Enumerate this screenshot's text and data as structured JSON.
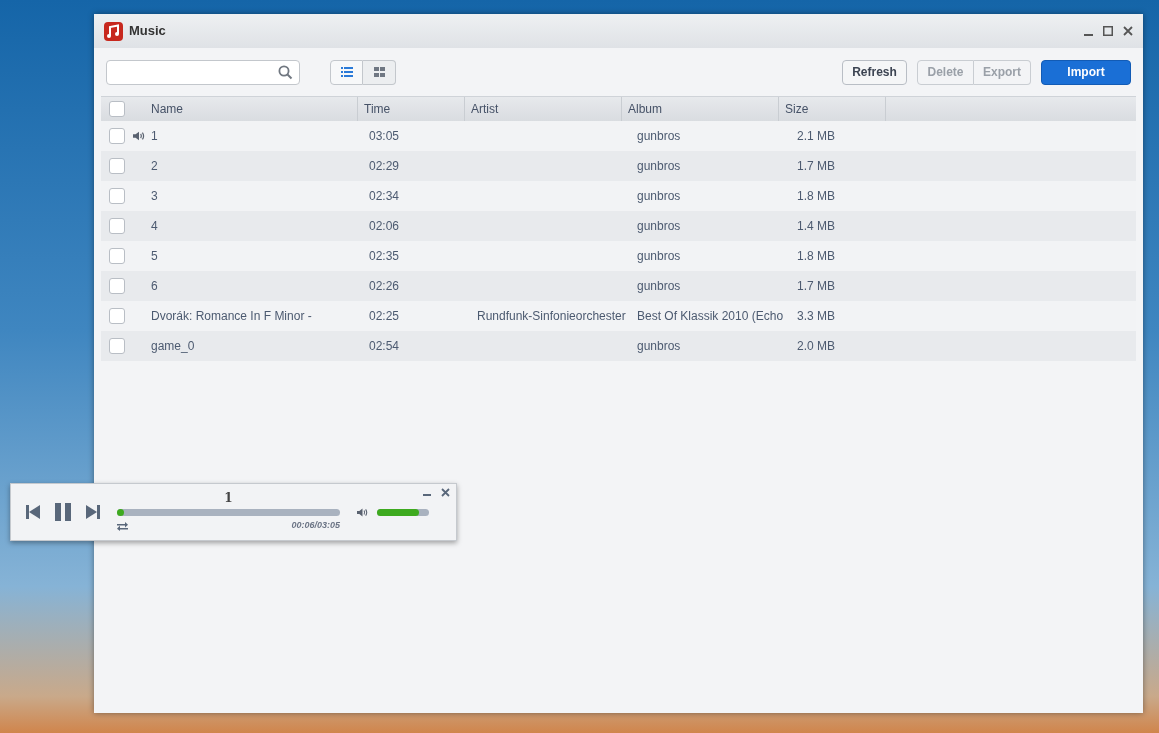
{
  "window": {
    "title": "Music"
  },
  "toolbar": {
    "view_modes": [
      {
        "kind": "list",
        "selected": true
      },
      {
        "kind": "grid",
        "selected": false
      }
    ],
    "buttons": [
      {
        "label": "Refresh",
        "disabled": false,
        "kind": "plain"
      },
      {
        "label": "Delete",
        "disabled": true,
        "kind": "group"
      },
      {
        "label": "Export",
        "disabled": true,
        "kind": "group"
      },
      {
        "label": "Import",
        "disabled": false,
        "kind": "primary"
      }
    ]
  },
  "table": {
    "select_all": {
      "checked": false
    },
    "columns": [
      "Name",
      "Time",
      "Artist",
      "Album",
      "Size"
    ],
    "rows": [
      {
        "checked": false,
        "playing": true,
        "cells": [
          "1",
          "03:05",
          "",
          "gunbros",
          "2.1 MB"
        ]
      },
      {
        "checked": false,
        "playing": false,
        "cells": [
          "2",
          "02:29",
          "",
          "gunbros",
          "1.7 MB"
        ]
      },
      {
        "checked": false,
        "playing": false,
        "cells": [
          "3",
          "02:34",
          "",
          "gunbros",
          "1.8 MB"
        ]
      },
      {
        "checked": false,
        "playing": false,
        "cells": [
          "4",
          "02:06",
          "",
          "gunbros",
          "1.4 MB"
        ]
      },
      {
        "checked": false,
        "playing": false,
        "cells": [
          "5",
          "02:35",
          "",
          "gunbros",
          "1.8 MB"
        ]
      },
      {
        "checked": false,
        "playing": false,
        "cells": [
          "6",
          "02:26",
          "",
          "gunbros",
          "1.7 MB"
        ]
      },
      {
        "checked": false,
        "playing": false,
        "cells": [
          "Dvorák: Romance In F Minor -",
          "02:25",
          "Rundfunk-Sinfonieorchester",
          "Best Of Klassik 2010 (Echo",
          "3.3 MB"
        ]
      },
      {
        "checked": false,
        "playing": false,
        "cells": [
          "game_0",
          "02:54",
          "",
          "gunbros",
          "2.0 MB"
        ]
      }
    ]
  },
  "mini_player": {
    "title": "1",
    "playing": true,
    "progress": {
      "level": 0.03
    },
    "time": "00:06/03:05",
    "volume": {
      "level": 0.8
    }
  }
}
